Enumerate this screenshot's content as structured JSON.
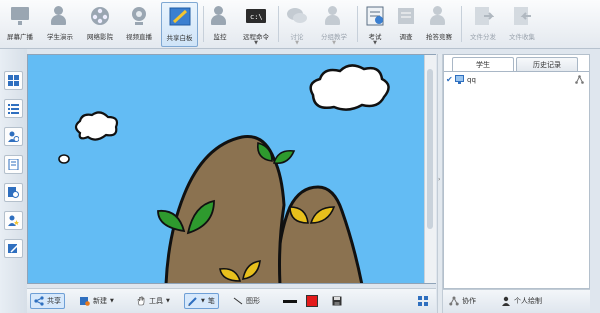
{
  "toolbar": {
    "items": [
      {
        "label": "屏幕广播",
        "icon": "screen-broadcast-icon"
      },
      {
        "label": "学生演示",
        "icon": "student-demo-icon"
      },
      {
        "label": "网络影院",
        "icon": "network-cinema-icon"
      },
      {
        "label": "视频直播",
        "icon": "video-live-icon"
      },
      {
        "label": "共享白板",
        "icon": "shared-whiteboard-icon"
      },
      {
        "label": "监控",
        "icon": "monitor-icon"
      },
      {
        "label": "远程命令",
        "icon": "remote-command-icon"
      },
      {
        "label": "讨论",
        "icon": "discussion-icon"
      },
      {
        "label": "分组教学",
        "icon": "group-teaching-icon"
      },
      {
        "label": "考试",
        "icon": "exam-icon"
      },
      {
        "label": "调查",
        "icon": "survey-icon"
      },
      {
        "label": "抢答竞赛",
        "icon": "quiz-contest-icon"
      },
      {
        "label": "文件分发",
        "icon": "file-distribute-icon"
      },
      {
        "label": "文件收集",
        "icon": "file-collect-icon"
      }
    ]
  },
  "sidebar": {
    "icons": [
      "grid-view-icon",
      "list-view-icon",
      "user-remove-icon",
      "document-icon",
      "clock-icon",
      "user-star-icon",
      "edit-icon"
    ]
  },
  "whiteboard_toolbar": {
    "share": "共享",
    "new": "新建",
    "tools": "工具",
    "pen": "笔",
    "shape": "图形",
    "color": "#e31b1b"
  },
  "right_panel": {
    "tabs": {
      "students": "学生",
      "history": "历史记录"
    },
    "students": [
      {
        "name": "qq",
        "checked": true
      }
    ],
    "footer": {
      "collaborate": "协作",
      "personal_draw": "个人绘制"
    }
  },
  "colors": {
    "sky": "#63bcf4",
    "mountain": "#8b7250",
    "leaf_green": "#2e9a2e",
    "leaf_yellow": "#e8c01c",
    "accent": "#2f6fbf"
  }
}
